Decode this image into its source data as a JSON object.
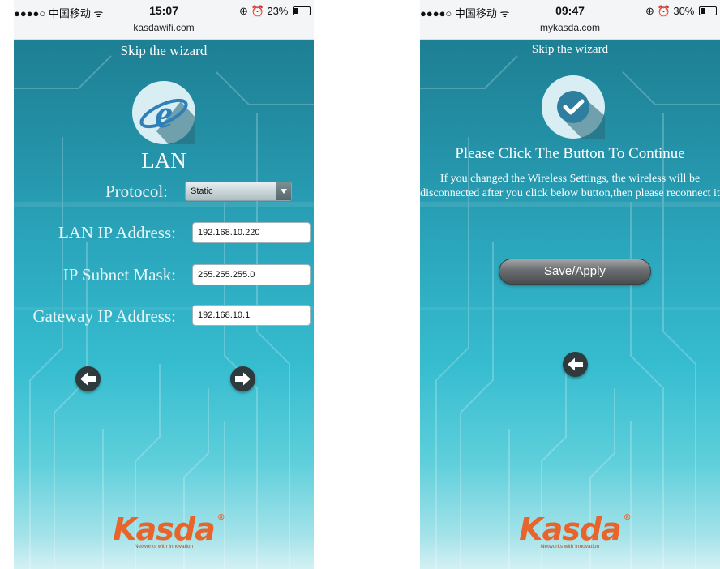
{
  "left": {
    "status": {
      "carrier": "●●●●○ 中国移动 ᯤ",
      "time": "15:07",
      "right": "⊕ ⏰ 23%",
      "battery_pct": 23
    },
    "url": "kasdawifi.com",
    "skip": "Skip the wizard",
    "title": "LAN",
    "protocol_label": "Protocol:",
    "protocol_value": "Static",
    "lan_ip_label": "LAN IP Address:",
    "lan_ip_value": "192.168.10.220",
    "subnet_label": "IP Subnet Mask:",
    "subnet_value": "255.255.255.0",
    "gateway_label": "Gateway IP Address:",
    "gateway_value": "192.168.10.1",
    "brand": "Kasda",
    "brand_reg": "®",
    "tagline": "Networks with Innovation",
    "logo_icon": "internet-explorer-icon",
    "nav_icons": [
      "arrow-left-icon",
      "arrow-right-icon"
    ]
  },
  "right": {
    "status": {
      "carrier": "●●●●○ 中国移动 ᯤ",
      "time": "09:47",
      "right": "⊕ ⏰ 30%",
      "battery_pct": 30
    },
    "url": "mykasda.com",
    "skip": "Skip the wizard",
    "heading": "Please Click The Button To Continue",
    "message": "If you changed the Wireless Settings, the wireless will be disconnected after you click below button,then please reconnect it",
    "button": "Save/Apply",
    "brand": "Kasda",
    "brand_reg": "®",
    "tagline": "Networks with Innovation",
    "logo_icon": "checkmark-icon",
    "nav_icons": [
      "arrow-left-icon"
    ]
  },
  "colors": {
    "accent": "#e8642a",
    "screen_top": "#1e7f93",
    "screen_bottom": "#d4f1f4",
    "nav_button": "#2f3a3d"
  }
}
